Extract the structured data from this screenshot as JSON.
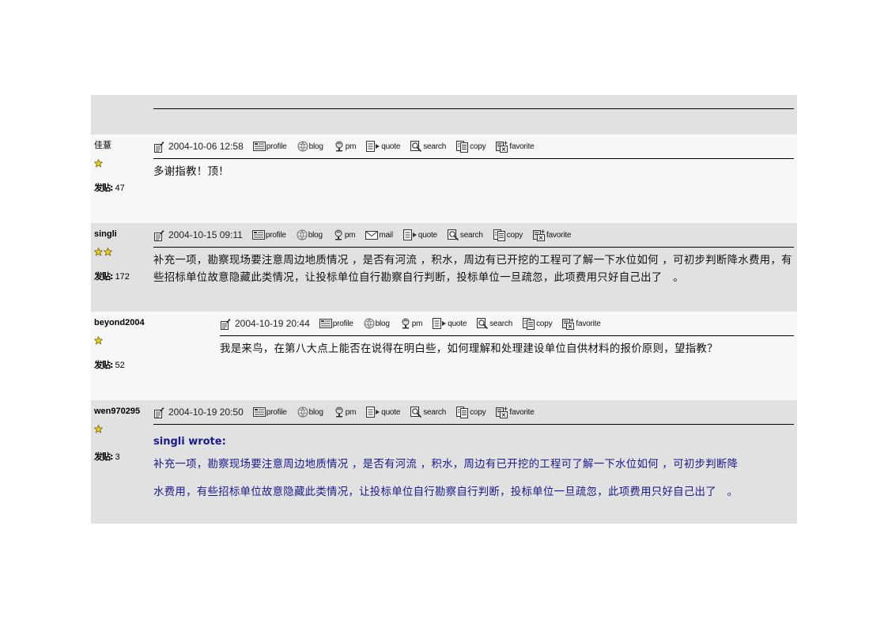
{
  "icons": {
    "post_icon": "post-document-icon",
    "profile": "profile-card-icon",
    "blog": "globe-icon",
    "pm": "pm-person-icon",
    "mail": "envelope-icon",
    "quote": "quote-arrow-icon",
    "search": "magnifier-icon",
    "copy": "copy-pages-icon",
    "favorite": "favorite-add-icon",
    "rank_star": "star-icon"
  },
  "labels": {
    "posts_label": "发贴:",
    "profile": "profile",
    "blog": "blog",
    "pm": "pm",
    "mail": "mail",
    "quote": "quote",
    "search": "search",
    "copy": "copy",
    "favorite": "favorite"
  },
  "colors": {
    "row_grey": "#e1e1e1",
    "row_light": "#f7f7f7",
    "quote_text": "#1a1a8c",
    "star": "#f2d21b"
  },
  "posts": [
    {
      "author": "佳薏",
      "stars": 1,
      "post_count": "47",
      "date": "2004-10-06 12:58",
      "actions": [
        "profile",
        "blog",
        "pm",
        "quote",
        "search",
        "copy",
        "favorite"
      ],
      "body": "多谢指教！顶！"
    },
    {
      "author": "singli",
      "stars": 2,
      "post_count": "172",
      "date": "2004-10-15 09:11",
      "actions": [
        "profile",
        "blog",
        "pm",
        "mail",
        "quote",
        "search",
        "copy",
        "favorite"
      ],
      "body": "补充一项，勘察现场要注意周边地质情况 ，是否有河流 ，积水，周边有已开挖的工程可了解一下水位如何 ，可初步判断降水费用，有些招标单位故意隐藏此类情况，让投标单位自行勘察自行判断，投标单位一旦疏忽，此项费用只好自己出了　。"
    },
    {
      "author": "beyond2004",
      "stars": 1,
      "post_count": "52",
      "date": "2004-10-19 20:44",
      "actions": [
        "profile",
        "blog",
        "pm",
        "quote",
        "search",
        "copy",
        "favorite"
      ],
      "body": "我是来鸟，在第八大点上能否在说得在明白些，如何理解和处理建设单位自供材料的报价原则，望指教？"
    },
    {
      "author": "wen970295",
      "stars": 1,
      "post_count": "3",
      "date": "2004-10-19 20:50",
      "actions": [
        "profile",
        "blog",
        "pm",
        "quote",
        "search",
        "copy",
        "favorite"
      ],
      "quote_author_line": "singli wrote:",
      "quote_line_1": "补充一项，勘察现场要注意周边地质情况 ，是否有河流 ，积水，周边有已开挖的工程可了解一下水位如何 ，可初步判断降",
      "quote_line_2": "水费用，有些招标单位故意隐藏此类情况，让投标单位自行勘察自行判断，投标单位一旦疏忽，此项费用只好自己出了　。"
    }
  ]
}
